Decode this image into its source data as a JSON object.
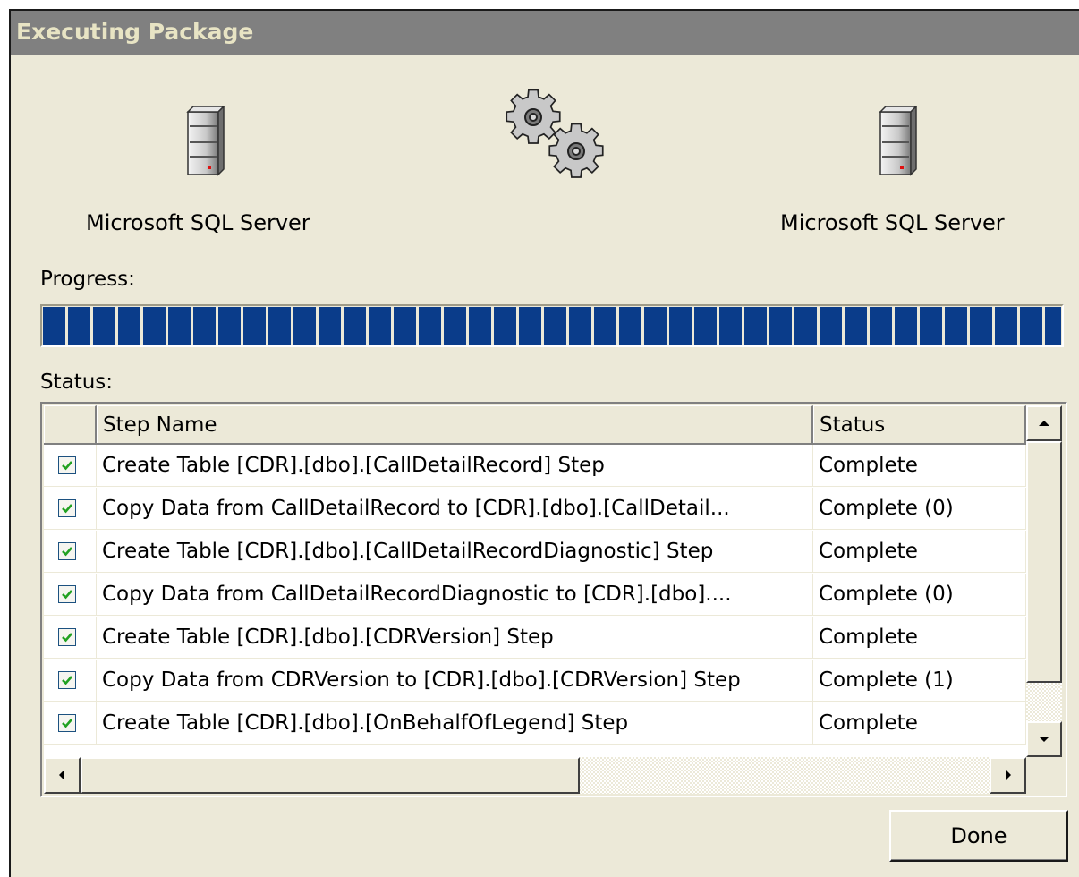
{
  "window": {
    "title": "Executing Package"
  },
  "source": {
    "label": "Microsoft SQL Server",
    "icon": "server-icon"
  },
  "destination": {
    "label": "Microsoft SQL Server",
    "icon": "server-icon"
  },
  "transfer_icon": "gears-icon",
  "progress": {
    "label": "Progress:",
    "value_percent": 100
  },
  "status": {
    "label": "Status:",
    "columns": [
      "",
      "Step Name",
      "Status"
    ],
    "rows": [
      {
        "checked": true,
        "name": "Create Table [CDR].[dbo].[CallDetailRecord] Step",
        "status": "Complete"
      },
      {
        "checked": true,
        "name": "Copy Data from CallDetailRecord to [CDR].[dbo].[CallDetail...",
        "status": "Complete (0)"
      },
      {
        "checked": true,
        "name": "Create Table [CDR].[dbo].[CallDetailRecordDiagnostic] Step",
        "status": "Complete"
      },
      {
        "checked": true,
        "name": "Copy Data from CallDetailRecordDiagnostic to [CDR].[dbo]....",
        "status": "Complete (0)"
      },
      {
        "checked": true,
        "name": "Create Table [CDR].[dbo].[CDRVersion] Step",
        "status": "Complete"
      },
      {
        "checked": true,
        "name": "Copy Data from CDRVersion to [CDR].[dbo].[CDRVersion] Step",
        "status": "Complete (1)"
      },
      {
        "checked": true,
        "name": "Create Table [CDR].[dbo].[OnBehalfOfLegend] Step",
        "status": "Complete"
      }
    ]
  },
  "buttons": {
    "done": "Done"
  },
  "colors": {
    "progress_fill": "#0a3c8a",
    "dialog_bg": "#ece9d8",
    "titlebar_bg": "#808080",
    "check": "#21a121"
  }
}
